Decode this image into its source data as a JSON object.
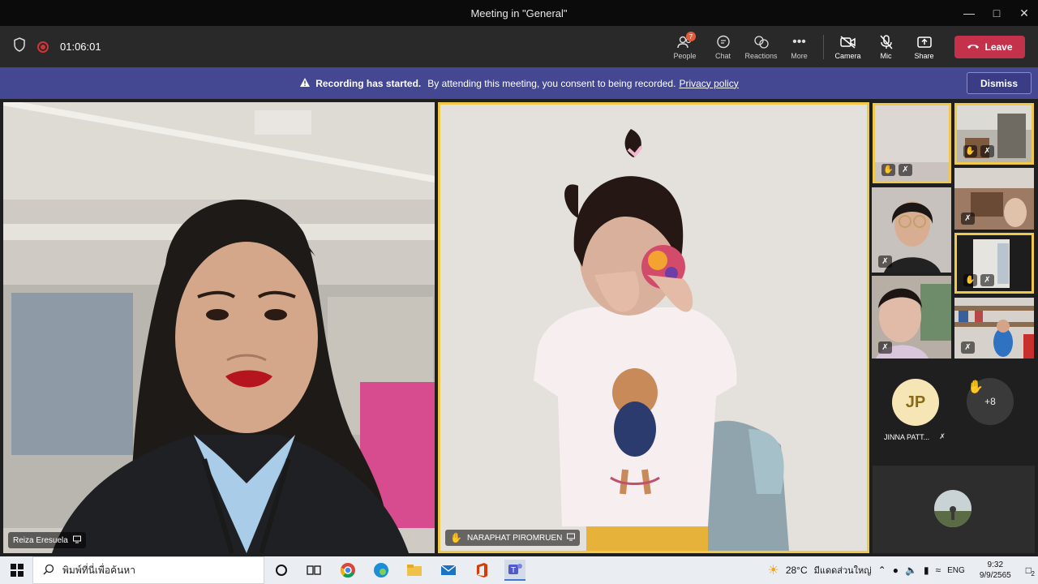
{
  "window": {
    "title": "Meeting in \"General\""
  },
  "toolbar": {
    "timer": "01:06:01",
    "people_label": "People",
    "people_count": "7",
    "chat_label": "Chat",
    "reactions_label": "Reactions",
    "more_label": "More",
    "camera_label": "Camera",
    "mic_label": "Mic",
    "share_label": "Share",
    "leave_label": "Leave"
  },
  "banner": {
    "title": "Recording has started.",
    "message": "By attending this meeting, you consent to being recorded.",
    "link": "Privacy policy",
    "dismiss": "Dismiss"
  },
  "participants": {
    "left_name": "Reiza Eresuela",
    "center_name": "NARAPHAT PIROMRUEN",
    "jp_initials": "JP",
    "jp_name": "JINNA PATT...",
    "more_count": "+8"
  },
  "taskbar": {
    "search_placeholder": "พิมพ์ที่นี่เพื่อค้นหา",
    "weather": "28°C",
    "weather_desc": "มีแดดส่วนใหญ่",
    "lang": "ENG",
    "time": "9:32",
    "date": "9/9/2565",
    "notif_count": "2"
  },
  "colors": {
    "leave": "#c4314b",
    "banner": "#444791",
    "highlight": "#f0c94a",
    "recording": "#d13438"
  }
}
